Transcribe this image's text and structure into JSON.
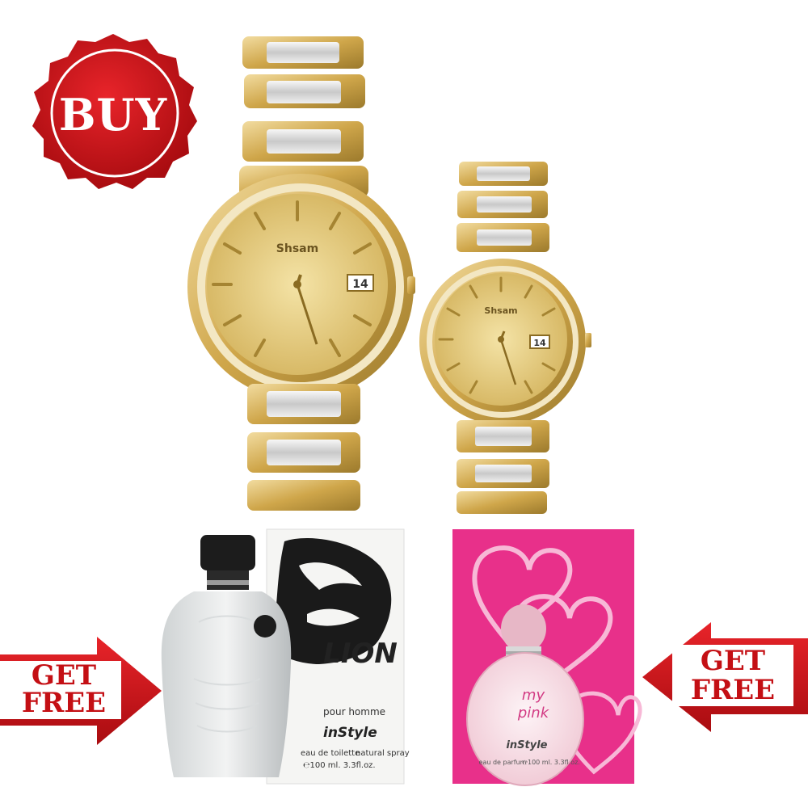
{
  "badge": {
    "label": "BUY"
  },
  "offers": {
    "left": {
      "line1": "GET",
      "line2": "FREE"
    },
    "right": {
      "line1": "GET",
      "line2": "FREE"
    }
  },
  "watches": {
    "brand": "Shsam",
    "date": "14"
  },
  "lion_perfume": {
    "name": "LION",
    "subtitle": "pour homme",
    "brand": "inStyle",
    "type": "eau de toilette",
    "spray": "natural spray",
    "volume": "℮100 ml. 3.3fl.oz."
  },
  "pink_perfume": {
    "name_line1": "my",
    "name_line2": "pink",
    "brand": "inStyle",
    "type": "eau de parfum",
    "volume": "℮100 ml. 3.3fl.oz."
  },
  "colors": {
    "badge_red": "#c40f14",
    "gold": "#d9b860",
    "pink_box": "#e8308a"
  }
}
